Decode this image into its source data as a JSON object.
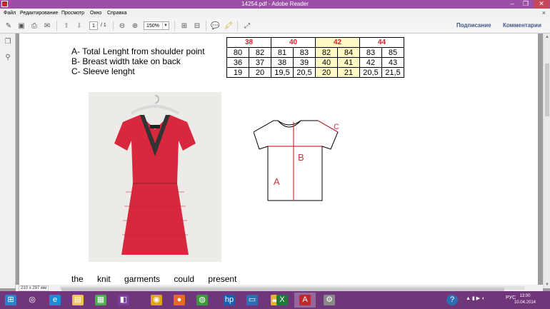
{
  "window": {
    "title": "14254.pdf - Adobe Reader",
    "minimize": "‒",
    "restore": "❐",
    "close": "✕"
  },
  "menu": {
    "items": [
      "Файл",
      "Редактирование",
      "Просмотр",
      "Окно",
      "Справка"
    ],
    "close_doc": "×"
  },
  "toolbar": {
    "page_current": "1",
    "page_total": "/ 1",
    "zoom": "150%",
    "sign": "Подписание",
    "comments": "Комментарии"
  },
  "document": {
    "labels": [
      "A- Total Lenght from shoulder point",
      "B- Breast width take on back",
      "C- Sleeve lenght"
    ],
    "size_table": {
      "sizes": [
        "38",
        "40",
        "42",
        "44"
      ],
      "highlight_size": "42",
      "rows": [
        [
          "80",
          "82",
          "81",
          "83",
          "82",
          "84",
          "83",
          "85"
        ],
        [
          "36",
          "37",
          "38",
          "39",
          "40",
          "41",
          "42",
          "43"
        ],
        [
          "19",
          "20",
          "19,5",
          "20,5",
          "20",
          "21",
          "20,5",
          "21,5"
        ]
      ]
    },
    "sketch_labels": {
      "a": "A",
      "b": "B",
      "c": "C"
    },
    "paragraph": "the knit garments could present"
  },
  "status": {
    "page_size": "210 x 297 мм"
  },
  "taskbar": {
    "apps": [
      "ie-icon",
      "explorer-icon",
      "store-icon",
      "media-icon",
      "firefox-icon",
      "chrome-icon",
      "hp-icon",
      "remote-icon",
      "folder-icon",
      "excel-icon",
      "acrobat-icon",
      "settings-icon"
    ],
    "tray_lang": "РУС",
    "time": "13:00",
    "date": "10.04.2014"
  }
}
